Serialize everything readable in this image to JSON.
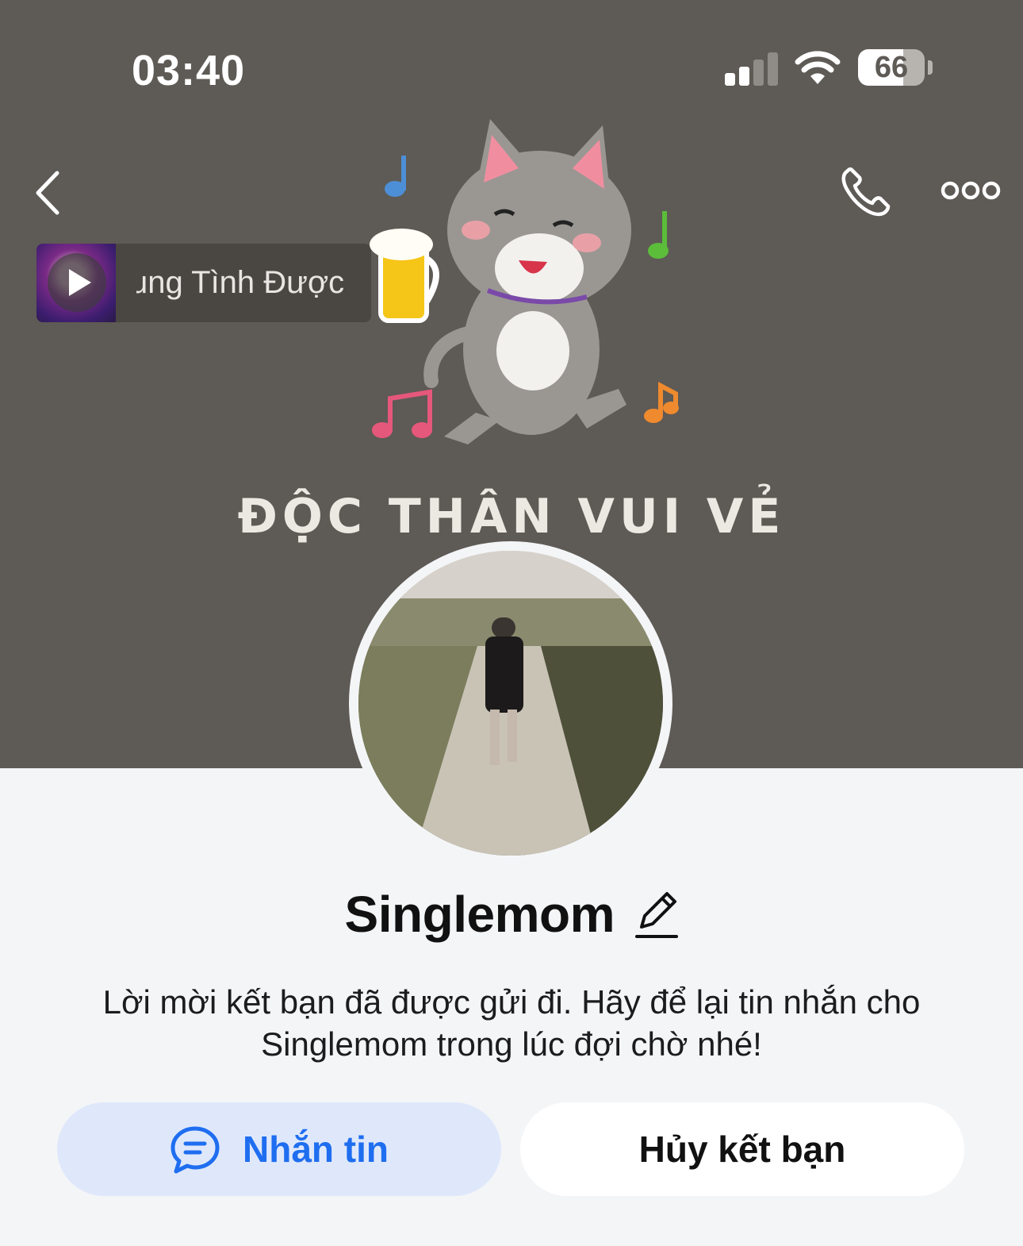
{
  "status_bar": {
    "time": "03:40",
    "battery_level": "66"
  },
  "nav": {
    "back_icon": "chevron-left-icon",
    "call_icon": "phone-icon",
    "more_icon": "more-dots-icon"
  },
  "music": {
    "title": "ung Tình Được"
  },
  "cover": {
    "caption": "ĐỘC THÂN VUI VẺ",
    "background_color": "#5e5a55"
  },
  "profile": {
    "name": "Singlemom",
    "invite_message": "Lời mời kết bạn đã được gửi đi. Hãy để lại tin nhắn cho Singlemom trong lúc đợi chờ nhé!"
  },
  "actions": {
    "message_label": "Nhắn tin",
    "unfriend_label": "Hủy kết bạn",
    "accent_color": "#1f6ef0"
  }
}
